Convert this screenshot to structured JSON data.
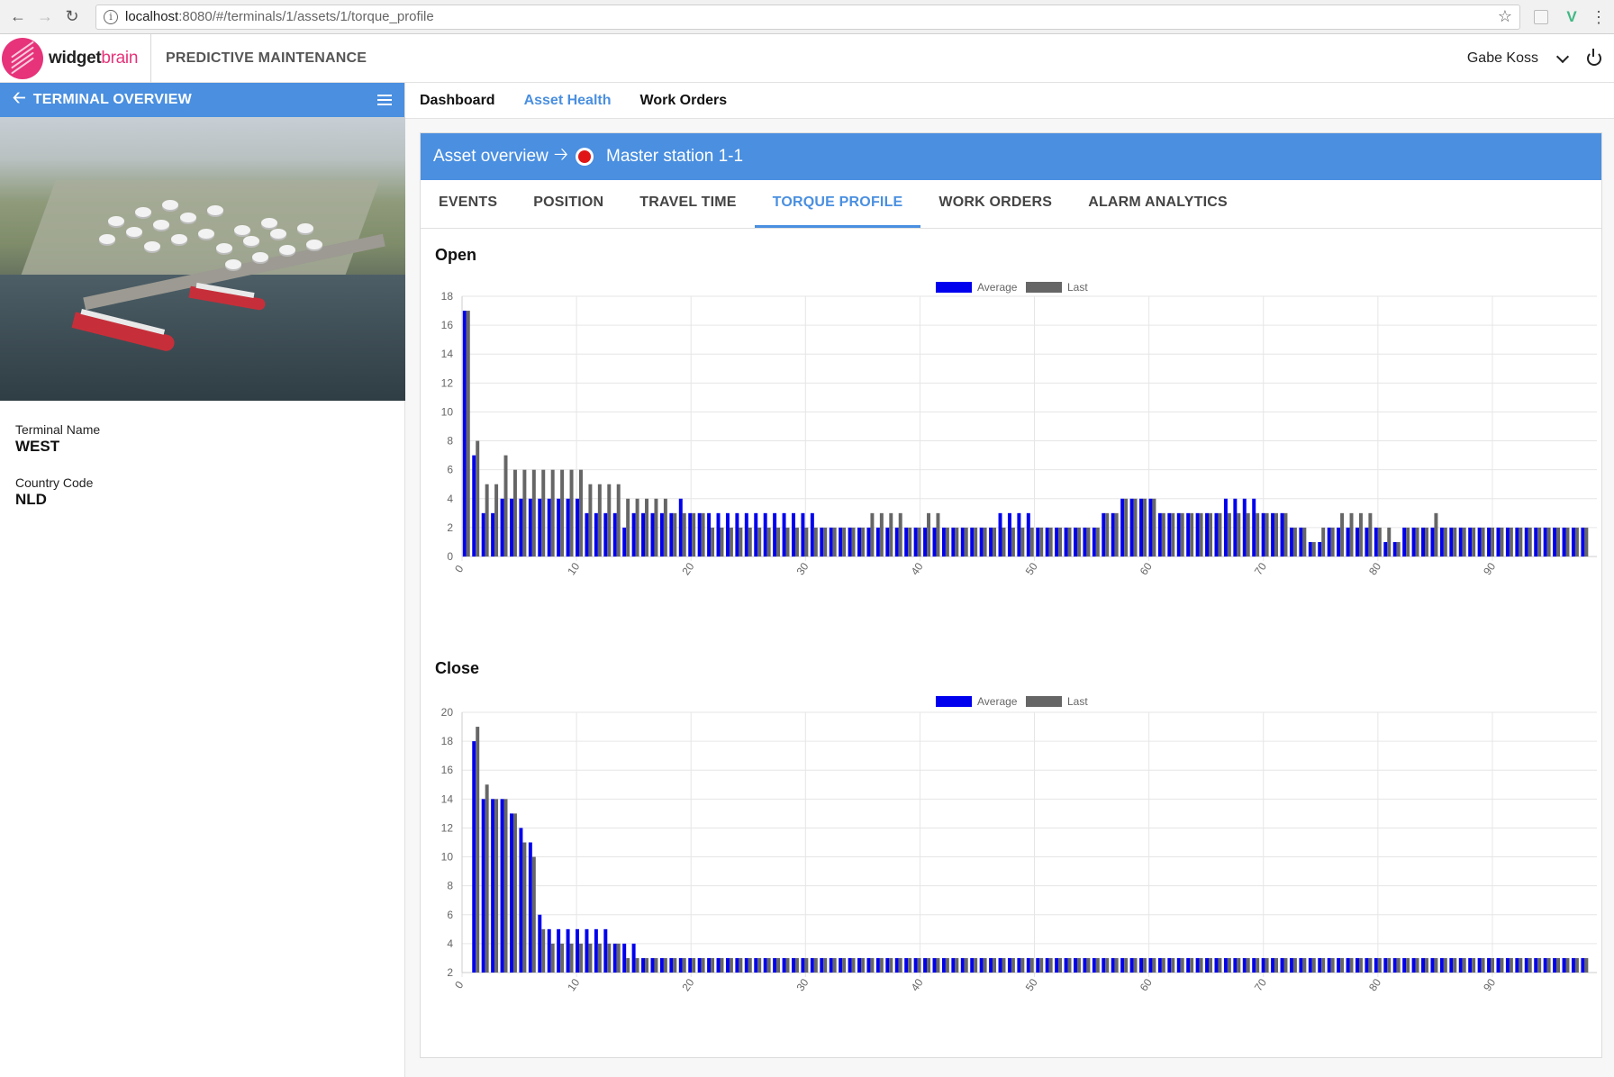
{
  "browser": {
    "url_host": "localhost",
    "url_path": ":8080/#/terminals/1/assets/1/torque_profile"
  },
  "header": {
    "logo_bold": "widget",
    "logo_light": "brain",
    "app_title": "PREDICTIVE MAINTENANCE",
    "user_name": "Gabe Koss"
  },
  "sidebar": {
    "title": "TERMINAL OVERVIEW",
    "fields": [
      {
        "label": "Terminal Name",
        "value": "WEST"
      },
      {
        "label": "Country Code",
        "value": "NLD"
      }
    ]
  },
  "nav": {
    "tabs": [
      {
        "label": "Dashboard",
        "active": false
      },
      {
        "label": "Asset Health",
        "active": true
      },
      {
        "label": "Work Orders",
        "active": false
      }
    ]
  },
  "asset": {
    "breadcrumb": "Asset overview",
    "name": "Master station 1-1",
    "status_color": "#e01616"
  },
  "subtabs": [
    {
      "label": "EVENTS",
      "active": false
    },
    {
      "label": "POSITION",
      "active": false
    },
    {
      "label": "TRAVEL TIME",
      "active": false
    },
    {
      "label": "TORQUE PROFILE",
      "active": true
    },
    {
      "label": "WORK ORDERS",
      "active": false
    },
    {
      "label": "ALARM ANALYTICS",
      "active": false
    }
  ],
  "colors": {
    "accent": "#4a8fe0",
    "average": "#0000ee",
    "last": "#666666"
  },
  "chart_data": [
    {
      "type": "bar",
      "title": "Open",
      "legend": [
        "Average",
        "Last"
      ],
      "legend_position": "top-center",
      "ylim": [
        0,
        18
      ],
      "yticks": [
        0,
        2,
        4,
        6,
        8,
        10,
        12,
        14,
        16,
        18
      ],
      "xticks": [
        0,
        10,
        20,
        30,
        40,
        50,
        60,
        70,
        80,
        90
      ],
      "grid": true,
      "series": [
        {
          "name": "Average",
          "values": [
            17,
            7,
            3,
            3,
            4,
            4,
            4,
            4,
            4,
            4,
            4,
            4,
            4,
            3,
            3,
            3,
            3,
            2,
            3,
            3,
            3,
            3,
            3,
            4,
            3,
            3,
            3,
            3,
            3,
            3,
            3,
            3,
            3,
            3,
            3,
            3,
            3,
            3,
            2,
            2,
            2,
            2,
            2,
            2,
            2,
            2,
            2,
            2,
            2,
            2,
            2,
            2,
            2,
            2,
            2,
            2,
            2,
            3,
            3,
            3,
            3,
            2,
            2,
            2,
            2,
            2,
            2,
            2,
            3,
            3,
            4,
            4,
            4,
            4,
            3,
            3,
            3,
            3,
            3,
            3,
            3,
            4,
            4,
            4,
            4,
            3,
            3,
            3,
            2,
            2,
            1,
            1,
            2,
            2,
            2,
            2,
            2,
            2,
            1,
            1,
            2,
            2,
            2,
            2,
            2,
            2,
            2,
            2,
            2,
            2,
            2,
            2,
            2,
            2,
            2,
            2,
            2,
            2,
            2,
            2
          ]
        },
        {
          "name": "Last",
          "values": [
            17,
            8,
            5,
            5,
            7,
            6,
            6,
            6,
            6,
            6,
            6,
            6,
            6,
            5,
            5,
            5,
            5,
            4,
            4,
            4,
            4,
            4,
            3,
            3,
            3,
            3,
            2,
            2,
            2,
            2,
            2,
            2,
            2,
            2,
            2,
            2,
            2,
            2,
            2,
            2,
            2,
            2,
            2,
            3,
            3,
            3,
            3,
            2,
            2,
            3,
            3,
            2,
            2,
            2,
            2,
            2,
            2,
            2,
            2,
            2,
            2,
            2,
            2,
            2,
            2,
            2,
            2,
            2,
            3,
            3,
            4,
            4,
            4,
            4,
            3,
            3,
            3,
            3,
            3,
            3,
            3,
            3,
            3,
            3,
            3,
            3,
            3,
            3,
            2,
            2,
            1,
            2,
            2,
            3,
            3,
            3,
            3,
            2,
            2,
            1,
            2,
            2,
            2,
            3,
            2,
            2,
            2,
            2,
            2,
            2,
            2,
            2,
            2,
            2,
            2,
            2,
            2,
            2,
            2,
            2
          ]
        }
      ]
    },
    {
      "type": "bar",
      "title": "Close",
      "legend": [
        "Average",
        "Last"
      ],
      "legend_position": "top-center",
      "ylim": [
        2,
        20
      ],
      "yticks": [
        2,
        4,
        6,
        8,
        10,
        12,
        14,
        16,
        18,
        20
      ],
      "xticks": [
        0,
        10,
        20,
        30,
        40,
        50,
        60,
        70,
        80,
        90
      ],
      "grid": true,
      "series": [
        {
          "name": "Average",
          "values": [
            2,
            18,
            14,
            14,
            14,
            13,
            12,
            11,
            6,
            5,
            5,
            5,
            5,
            5,
            5,
            5,
            4,
            4,
            4,
            3,
            3,
            3,
            3,
            3,
            3,
            3,
            3,
            3,
            3,
            3,
            3,
            3,
            3,
            3,
            3,
            3,
            3,
            3,
            3,
            3,
            3,
            3,
            3,
            3,
            3,
            3,
            3,
            3,
            3,
            3,
            3,
            3,
            3,
            3,
            3,
            3,
            3,
            3,
            3,
            3,
            3,
            3,
            3,
            3,
            3,
            3,
            3,
            3,
            3,
            3,
            3,
            3,
            3,
            3,
            3,
            3,
            3,
            3,
            3,
            3,
            3,
            3,
            3,
            3,
            3,
            3,
            3,
            3,
            3,
            3,
            3,
            3,
            3,
            3,
            3,
            3,
            3,
            3,
            3,
            3,
            3,
            3,
            3,
            3,
            3,
            3,
            3,
            3,
            3,
            3,
            3,
            3,
            3,
            3,
            3,
            3,
            3,
            3,
            3,
            3
          ]
        },
        {
          "name": "Last",
          "values": [
            2,
            19,
            15,
            14,
            14,
            13,
            11,
            10,
            5,
            4,
            4,
            4,
            4,
            4,
            4,
            4,
            4,
            3,
            3,
            3,
            3,
            3,
            3,
            3,
            3,
            3,
            3,
            3,
            3,
            3,
            3,
            3,
            3,
            3,
            3,
            3,
            3,
            3,
            3,
            3,
            3,
            3,
            3,
            3,
            3,
            3,
            3,
            3,
            3,
            3,
            3,
            3,
            3,
            3,
            3,
            3,
            3,
            3,
            3,
            3,
            3,
            3,
            3,
            3,
            3,
            3,
            3,
            3,
            3,
            3,
            3,
            3,
            3,
            3,
            3,
            3,
            3,
            3,
            3,
            3,
            3,
            3,
            3,
            3,
            3,
            3,
            3,
            3,
            3,
            3,
            3,
            3,
            3,
            3,
            3,
            3,
            3,
            3,
            3,
            3,
            3,
            3,
            3,
            3,
            3,
            3,
            3,
            3,
            3,
            3,
            3,
            3,
            3,
            3,
            3,
            3,
            3,
            3,
            3,
            3
          ]
        }
      ]
    }
  ]
}
